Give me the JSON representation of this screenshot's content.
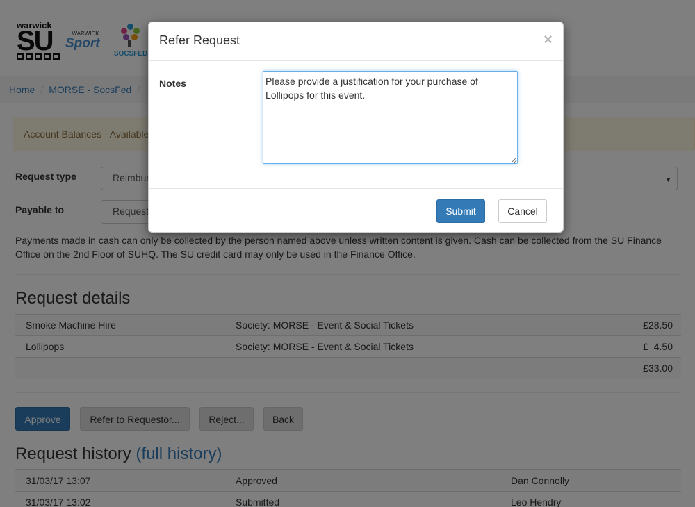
{
  "header": {
    "logo_warwick": "warwick",
    "logo_su": "SU",
    "logo_sport_top": "WARWICK",
    "logo_sport": "Sport",
    "logo_socsfed": "SOCSFED"
  },
  "breadcrumb": {
    "items": [
      "Home",
      "MORSE - SocsFed"
    ]
  },
  "alert": {
    "text": "Account Balances - Available"
  },
  "form": {
    "request_type_label": "Request type",
    "request_type_value": "Reimbursement",
    "payable_to_label": "Payable to",
    "payable_to_value": "Requestor"
  },
  "note": "Payments made in cash can only be collected by the person named above unless written content is given. Cash can be collected from the SU Finance Office on the 2nd Floor of SUHQ. The SU credit card may only be used in the Finance Office.",
  "request_details": {
    "title": "Request details",
    "rows": [
      {
        "item": "Smoke Machine Hire",
        "account": "Society: MORSE - Event & Social Tickets",
        "amount": "£28.50"
      },
      {
        "item": "Lollipops",
        "account": "Society: MORSE - Event & Social Tickets",
        "amount": "£  4.50"
      }
    ],
    "total": "£33.00"
  },
  "actions": {
    "approve": "Approve",
    "refer": "Refer to Requestor...",
    "reject": "Reject...",
    "back": "Back"
  },
  "request_history": {
    "title": "Request history",
    "link": "(full history)",
    "rows": [
      {
        "time": "31/03/17 13:07",
        "status": "Approved",
        "user": "Dan Connolly"
      },
      {
        "time": "31/03/17 13:02",
        "status": "Submitted",
        "user": "Leo Hendry"
      }
    ]
  },
  "modal": {
    "title": "Refer Request",
    "close": "×",
    "notes_label": "Notes",
    "notes_value": "Please provide a justification for your purchase of Lollipops for this event.",
    "submit": "Submit",
    "cancel": "Cancel"
  },
  "colors": {
    "primary": "#337ab7",
    "alert_bg": "#fcf8e3",
    "alert_text": "#8a6d3b"
  }
}
